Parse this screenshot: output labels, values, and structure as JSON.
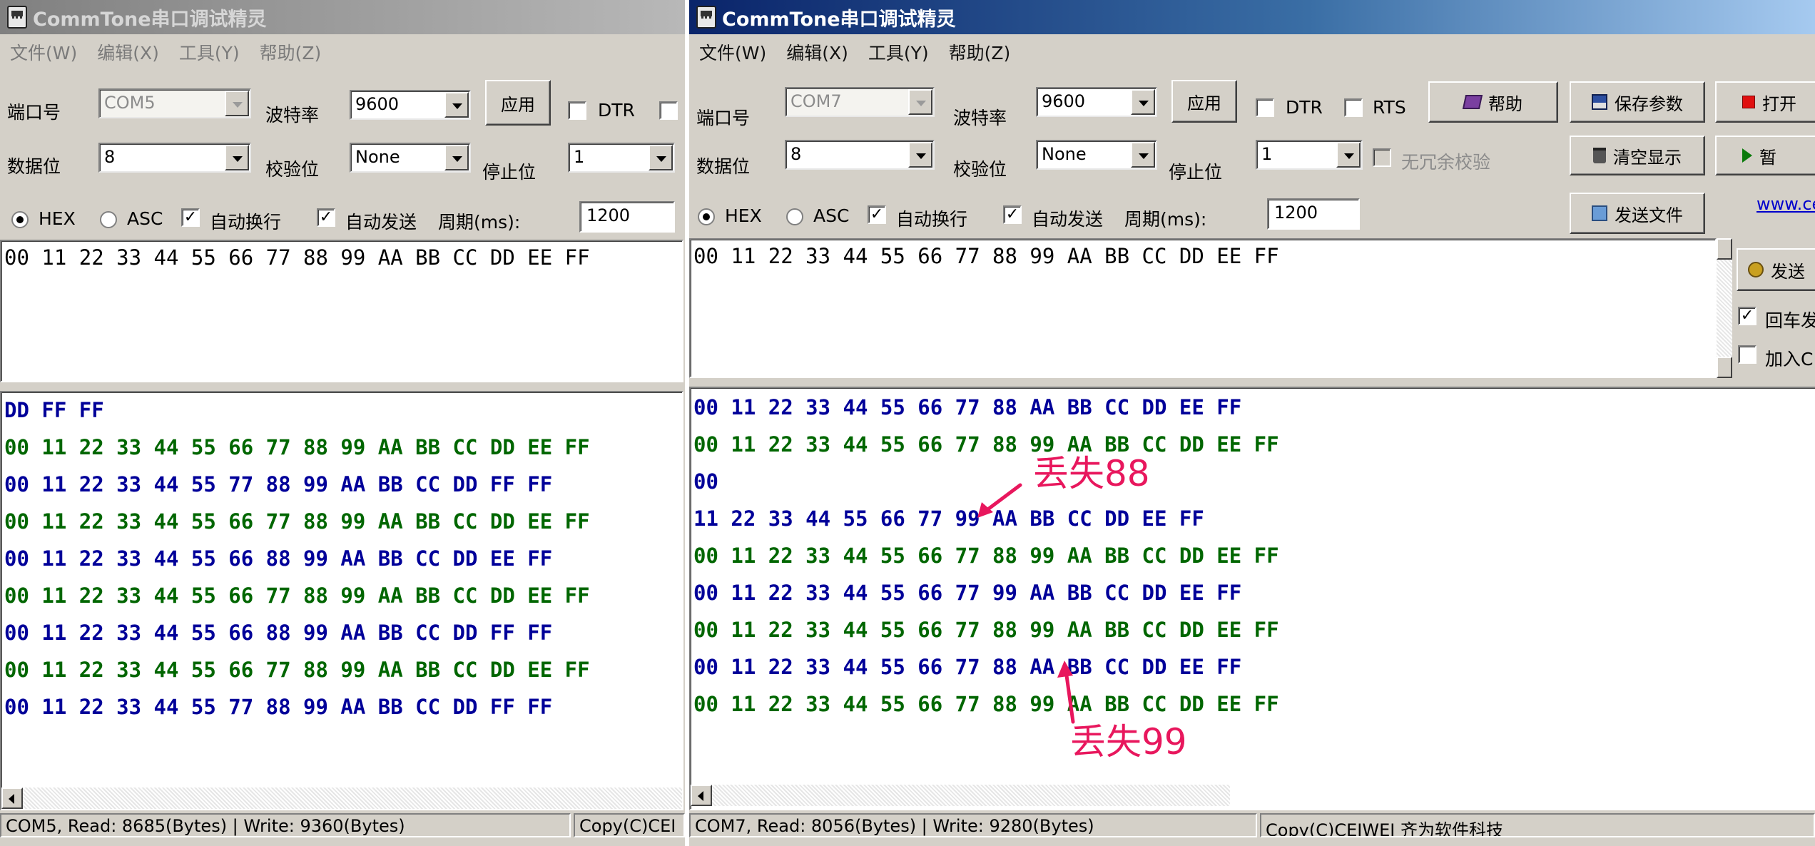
{
  "left": {
    "title": "CommTone串口调试精灵",
    "menu": [
      "文件(W)",
      "编辑(X)",
      "工具(Y)",
      "帮助(Z)"
    ],
    "labels": {
      "port": "端口号",
      "baud": "波特率",
      "databits": "数据位",
      "parity": "校验位",
      "stopbits": "停止位"
    },
    "port_value": "COM5",
    "baud_value": "9600",
    "databits_value": "8",
    "parity_value": "None",
    "stopbits_value": "1",
    "apply_label": "应用",
    "dtr_label": "DTR",
    "hex_label": "HEX",
    "asc_label": "ASC",
    "autowrap_label": "自动换行",
    "autosend_label": "自动发送",
    "period_label": "周期(ms):",
    "period_value": "1200",
    "send_text": "00 11 22 33 44 55 66 77 88 99 AA BB CC DD EE FF",
    "recv_lines": [
      {
        "text": "DD FF FF",
        "color": "#000099"
      },
      {
        "text": "00 11 22 33 44 55 66 77 88 99 AA BB CC DD EE FF",
        "color": "#006600"
      },
      {
        "text": "00 11 22 33 44 55 77 88 99 AA BB CC DD FF FF",
        "color": "#000099"
      },
      {
        "text": "00 11 22 33 44 55 66 77 88 99 AA BB CC DD EE FF",
        "color": "#006600"
      },
      {
        "text": "00 11 22 33 44 55 66 88 99 AA BB CC DD EE FF",
        "color": "#000099"
      },
      {
        "text": "00 11 22 33 44 55 66 77 88 99 AA BB CC DD EE FF",
        "color": "#006600"
      },
      {
        "text": "00 11 22 33 44 55 66 88 99 AA BB CC DD FF FF",
        "color": "#000099"
      },
      {
        "text": "00 11 22 33 44 55 66 77 88 99 AA BB CC DD EE FF",
        "color": "#006600"
      },
      {
        "text": "00 11 22 33 44 55 77 88 99 AA BB CC DD FF FF",
        "color": "#000099"
      }
    ],
    "status_left": "COM5, Read: 8685(Bytes) | Write: 9360(Bytes)",
    "status_right": "Copy(C)CEI"
  },
  "right": {
    "title": "CommTone串口调试精灵",
    "menu": [
      "文件(W)",
      "编辑(X)",
      "工具(Y)",
      "帮助(Z)"
    ],
    "labels": {
      "port": "端口号",
      "baud": "波特率",
      "databits": "数据位",
      "parity": "校验位",
      "stopbits": "停止位"
    },
    "port_value": "COM7",
    "baud_value": "9600",
    "databits_value": "8",
    "parity_value": "None",
    "stopbits_value": "1",
    "apply_label": "应用",
    "dtr_label": "DTR",
    "rts_label": "RTS",
    "redundancy_label": "无冗余校验",
    "help_label": "帮助",
    "save_params_label": "保存参数",
    "open_label": "打开",
    "clear_label": "清空显示",
    "pause_label": "暂",
    "send_file_label": "发送文件",
    "send_label": "发送",
    "link_label": "www.ce",
    "cr_label": "回车发",
    "add_label": "加入C",
    "hex_label": "HEX",
    "asc_label": "ASC",
    "autowrap_label": "自动换行",
    "autosend_label": "自动发送",
    "period_label": "周期(ms):",
    "period_value": "1200",
    "send_text": "00 11 22 33 44 55 66 77 88 99 AA BB CC DD EE FF",
    "recv_lines": [
      {
        "text": "00 11 22 33 44 55 66 77 88 AA BB CC DD EE FF",
        "color": "#000099"
      },
      {
        "text": "00 11 22 33 44 55 66 77 88 99 AA BB CC DD EE FF",
        "color": "#006600"
      },
      {
        "text": "00",
        "color": "#000099"
      },
      {
        "text": "11 22 33 44 55 66 77 99 AA BB CC DD EE FF",
        "color": "#000099"
      },
      {
        "text": "00 11 22 33 44 55 66 77 88 99 AA BB CC DD EE FF",
        "color": "#006600"
      },
      {
        "text": "00 11 22 33 44 55 66 77 99 AA BB CC DD EE FF",
        "color": "#000099"
      },
      {
        "text": "00 11 22 33 44 55 66 77 88 99 AA BB CC DD EE FF",
        "color": "#006600"
      },
      {
        "text": "00 11 22 33 44 55 66 77 88 AA BB CC DD EE FF",
        "color": "#000099"
      },
      {
        "text": "00 11 22 33 44 55 66 77 88 99 AA BB CC DD EE FF",
        "color": "#006600"
      }
    ],
    "status_left": "COM7, Read: 8056(Bytes) | Write: 9280(Bytes)",
    "status_right": "Copy(C)CEIWEI 齐为软件科技"
  },
  "annotations": {
    "lost88": "丢失88",
    "lost99": "丢失99",
    "color": "#e8175d"
  }
}
